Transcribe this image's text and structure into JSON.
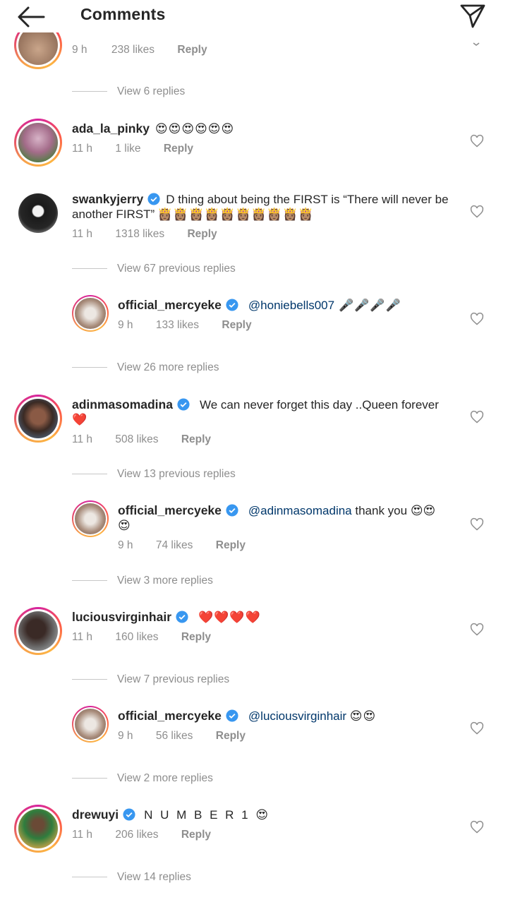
{
  "header": {
    "title": "Comments",
    "back_icon": "arrow-left-icon",
    "send_icon": "paper-plane-icon"
  },
  "top_partial": {
    "time": "9 h",
    "likes": "238 likes",
    "reply": "Reply",
    "view_replies": "View 6 replies"
  },
  "comments": [
    {
      "username": "ada_la_pinky",
      "verified": false,
      "text": "😍😍😍😍😍😍",
      "time": "11 h",
      "likes": "1 like",
      "reply": "Reply"
    },
    {
      "username": "swankyjerry",
      "verified": true,
      "text": "D thing about being the FIRST is “There will never be another FIRST”",
      "emoji": "👸🏽👸🏽👸🏽👸🏽👸🏽👸🏽👸🏽👸🏽👸🏽👸🏽",
      "time": "11 h",
      "likes": "1318 likes",
      "reply": "Reply",
      "view_replies": "View 67 previous replies"
    },
    {
      "username": "official_mercyeke",
      "verified": true,
      "mention": "@honiebells007",
      "text": "🎤🎤🎤🎤",
      "time": "9 h",
      "likes": "133 likes",
      "reply": "Reply",
      "view_replies": "View 26 more replies"
    },
    {
      "username": "adinmasomadina",
      "verified": true,
      "text": "We can never forget this day ..Queen forever",
      "emoji": "❤️",
      "time": "11 h",
      "likes": "508 likes",
      "reply": "Reply",
      "view_replies": "View 13 previous replies"
    },
    {
      "username": "official_mercyeke",
      "verified": true,
      "mention": "@adinmasomadina",
      "text": "thank you 😍😍",
      "emoji": "😍",
      "time": "9 h",
      "likes": "74 likes",
      "reply": "Reply",
      "view_replies": "View 3 more replies"
    },
    {
      "username": "luciousvirginhair",
      "verified": true,
      "text": "❤️❤️❤️❤️",
      "time": "11 h",
      "likes": "160 likes",
      "reply": "Reply",
      "view_replies": "View 7 previous replies"
    },
    {
      "username": "official_mercyeke",
      "verified": true,
      "mention": "@luciousvirginhair",
      "text": "😍😍",
      "time": "9 h",
      "likes": "56 likes",
      "reply": "Reply",
      "view_replies": "View 2 more replies"
    },
    {
      "username": "drewuyi",
      "verified": true,
      "text": "N U M B E R  1 😍",
      "time": "11 h",
      "likes": "206 likes",
      "reply": "Reply",
      "view_replies": "View 14 replies"
    }
  ],
  "colors": {
    "verified_blue": "#3897f0",
    "mention_blue": "#00376b",
    "muted_gray": "#8e8e8e",
    "ring_gradient": [
      "#d6249f",
      "#fd5949",
      "#fdb543"
    ]
  }
}
